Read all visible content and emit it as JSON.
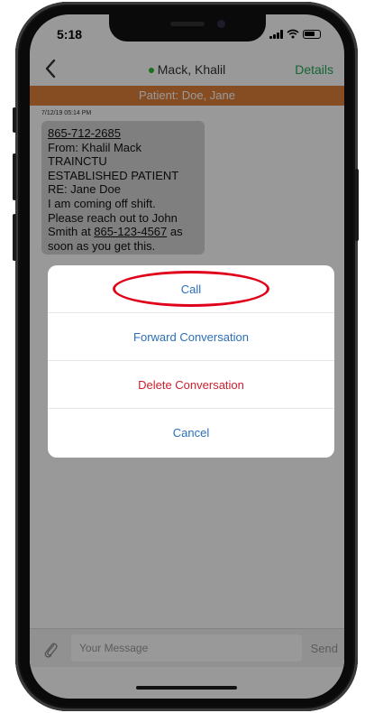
{
  "status_bar": {
    "time": "5:18"
  },
  "nav": {
    "contact_name": "Mack, Khalil",
    "details_label": "Details"
  },
  "patient_banner": "Patient: Doe, Jane",
  "message": {
    "timestamp": "7/12/19 05:14 PM",
    "lines": [
      "865-712-2685",
      "From: Khalil Mack",
      "TRAINCTU",
      "ESTABLISHED PATIENT",
      "RE: Jane Doe",
      "I am coming off shift.",
      "Please reach out to John",
      "Smith at ",
      "865-123-4567",
      " as",
      "soon as you get this."
    ]
  },
  "action_sheet": {
    "items": [
      "Call",
      "Forward Conversation",
      "Delete Conversation",
      "Cancel"
    ]
  },
  "composer": {
    "placeholder": "Your Message",
    "send_label": "Send"
  },
  "colors": {
    "banner": "#e07f3a",
    "online": "#2eb82e",
    "details": "#22a855",
    "action_blue": "#2b6fb8",
    "action_red": "#cc1f2f",
    "annotation_ring": "#e0001a"
  },
  "icons": {
    "back": "chevron-left-icon",
    "attach": "paperclip-icon",
    "signal": "signal-icon",
    "wifi": "wifi-icon",
    "battery": "battery-icon"
  }
}
